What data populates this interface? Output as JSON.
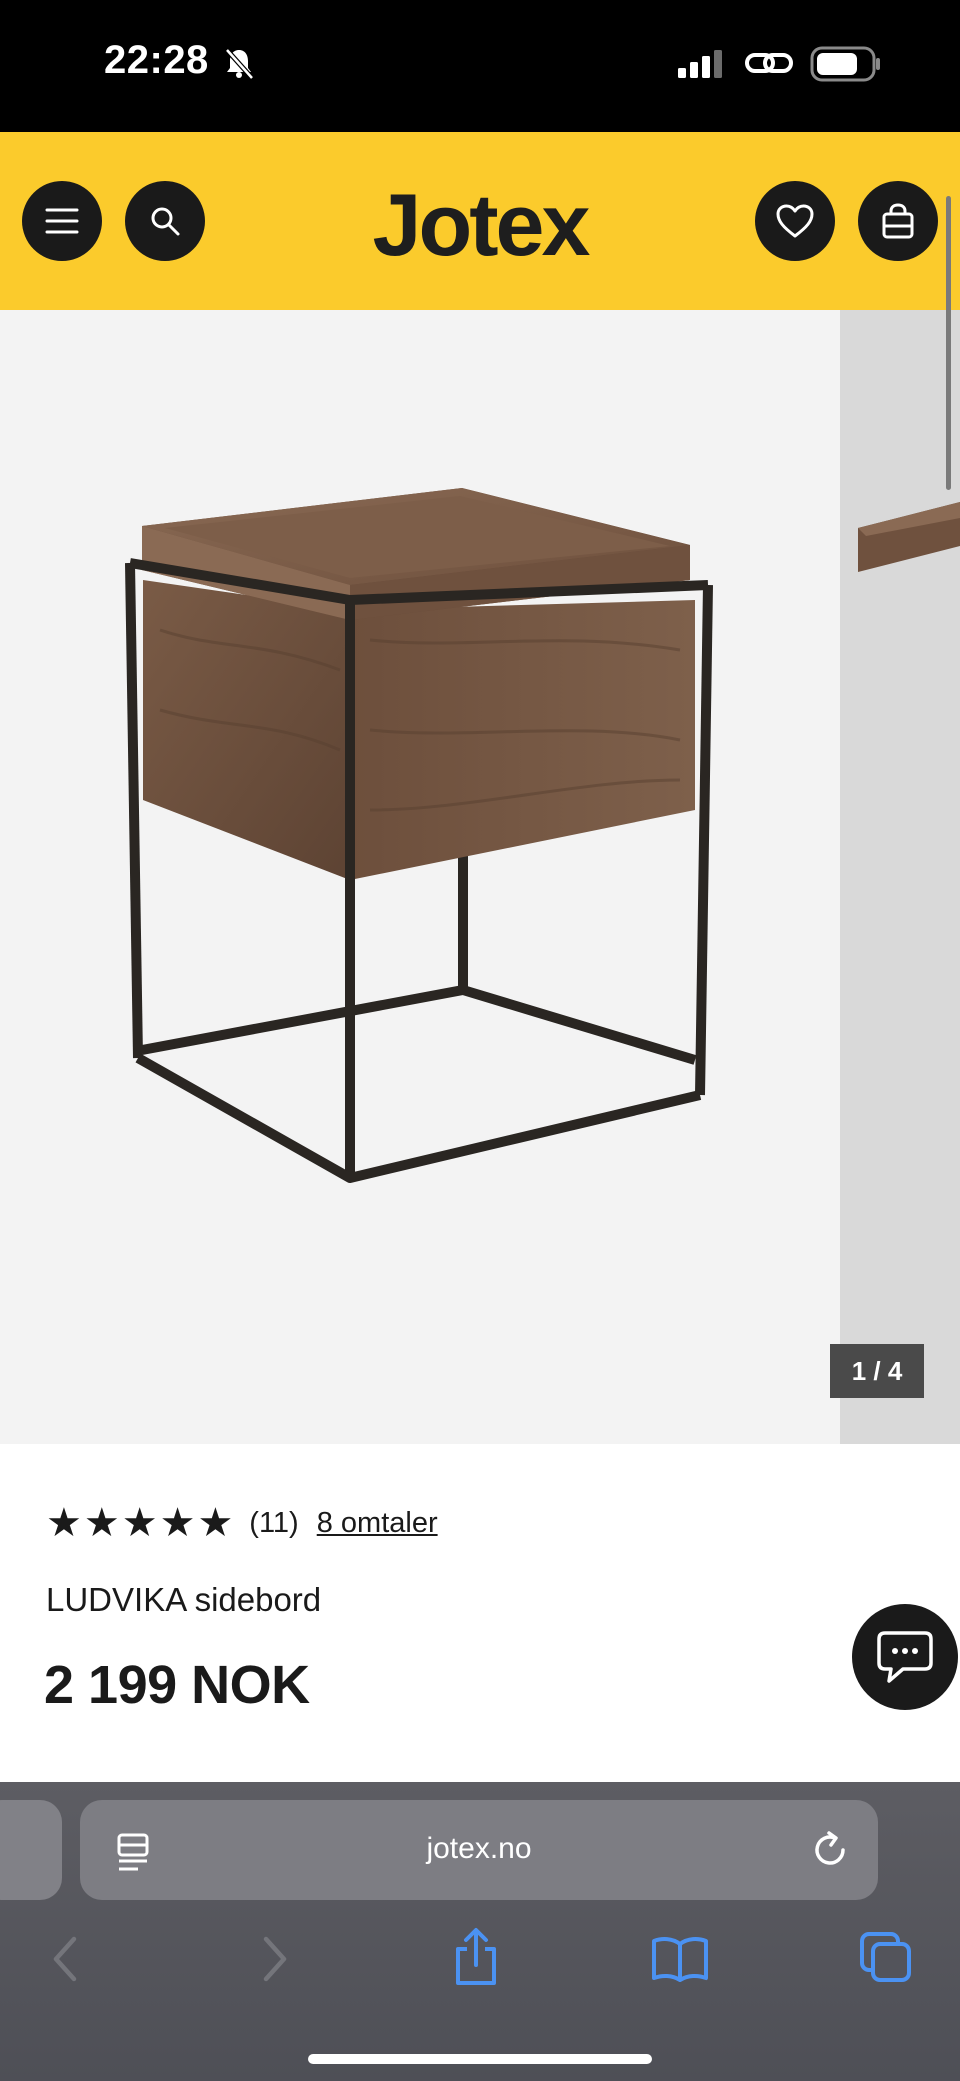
{
  "status_bar": {
    "time": "22:28"
  },
  "header": {
    "logo": "Jotex"
  },
  "gallery": {
    "counter": "1 / 4"
  },
  "product": {
    "rating_stars": 5,
    "rating_count": "(11)",
    "reviews_link": "8 omtaler",
    "name": "LUDVIKA sidebord",
    "price": "2 199 NOK"
  },
  "browser": {
    "url": "jotex.no"
  },
  "colors": {
    "brand_yellow": "#fbcb2c",
    "dark": "#1a1a1a",
    "browser_accent": "#3b82f6"
  }
}
